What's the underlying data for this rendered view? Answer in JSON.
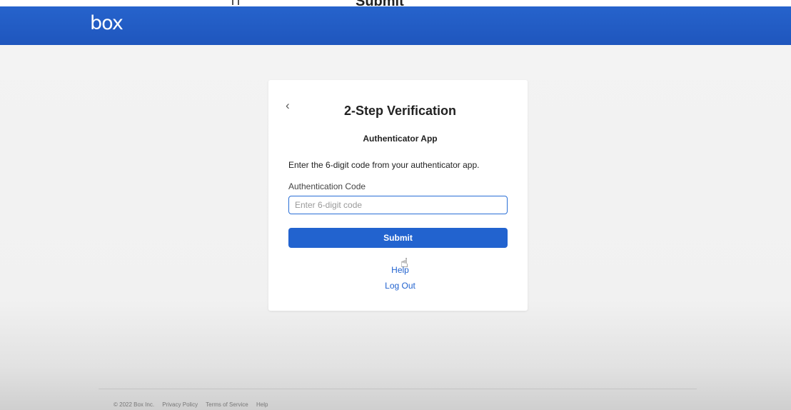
{
  "top_strip": {
    "text": "Submit"
  },
  "header": {
    "logo": "box",
    "brand_color": "#2263cf"
  },
  "card": {
    "back_icon": "chevron-left-icon",
    "back_glyph": "‹",
    "title": "2-Step Verification",
    "subtitle": "Authenticator App",
    "instructions": "Enter the 6-digit code from your authenticator app.",
    "field_label": "Authentication Code",
    "input_value": "",
    "input_placeholder": "Enter 6-digit code",
    "submit_label": "Submit",
    "help_link": "Help",
    "logout_link": "Log Out"
  },
  "cursor": {
    "icon": "hand-pointer-icon",
    "glyph": "☝"
  },
  "footer": {
    "copyright": "© 2022 Box Inc.",
    "links": [
      "Privacy Policy",
      "Terms of Service",
      "Help"
    ]
  }
}
